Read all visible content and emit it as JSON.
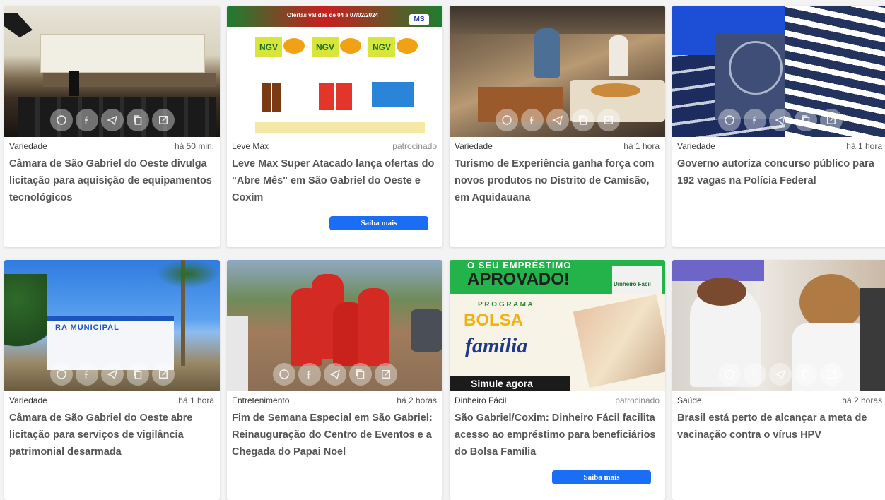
{
  "colors": {
    "accent": "#1a6ef5",
    "title": "#555555",
    "meta": "#333333"
  },
  "share_icons": [
    "whatsapp-icon",
    "facebook-icon",
    "telegram-icon",
    "copy-icon",
    "external-link-icon"
  ],
  "cards": [
    {
      "category": "Variedade",
      "time": "há 50 min.",
      "title": "Câmara de São Gabriel do Oeste divulga licitação para aquisição de equipamentos tecnológicos"
    },
    {
      "category": "Leve Max",
      "time": "patrocinado",
      "title": "Leve Max Super Atacado lança ofertas do \"Abre Mês\" em São Gabriel do Oeste e Coxim",
      "button": "Saiba mais"
    },
    {
      "category": "Variedade",
      "time": "há 1 hora",
      "title": "Turismo de Experiência ganha força com novos produtos no Distrito de Camisão, em Aquidauana"
    },
    {
      "category": "Variedade",
      "time": "há 1 hora",
      "title": "Governo autoriza concurso público para 192 vagas na Polícia Federal"
    },
    {
      "category": "Variedade",
      "time": "há 1 hora",
      "title": "Câmara de São Gabriel do Oeste abre licitação para serviços de vigilância patrimonial desarmada"
    },
    {
      "category": "Entretenimento",
      "time": "há 2 horas",
      "title": "Fim de Semana Especial em São Gabriel: Reinauguração do Centro de Eventos e a Chegada do Papai Noel"
    },
    {
      "category": "Dinheiro Fácil",
      "time": "patrocinado",
      "title": "São Gabriel/Coxim: Dinheiro Fácil facilita acesso ao empréstimo para beneficiários do Bolsa Família",
      "button": "Saiba mais"
    },
    {
      "category": "Saúde",
      "time": "há 2 horas",
      "title": "Brasil está perto de alcançar a meta de vacinação contra o vírus HPV"
    }
  ],
  "ad_texts": {
    "levemax_banner": "Ofertas válidas de 04 a 07/02/2024",
    "levemax_tag": "MS",
    "ngv": "NGV",
    "dinheiro_headline1": "O SEU EMPRÉSTIMO",
    "dinheiro_headline2": "APROVADO!",
    "dinheiro_brand": "Dinheiro Fácil",
    "dinheiro_programa": "P R O G R A M A",
    "dinheiro_bolsa": "BOLSA",
    "dinheiro_familia": "família",
    "dinheiro_cta": "Simule agora",
    "camara_sign": "RA MUNICIPAL"
  }
}
